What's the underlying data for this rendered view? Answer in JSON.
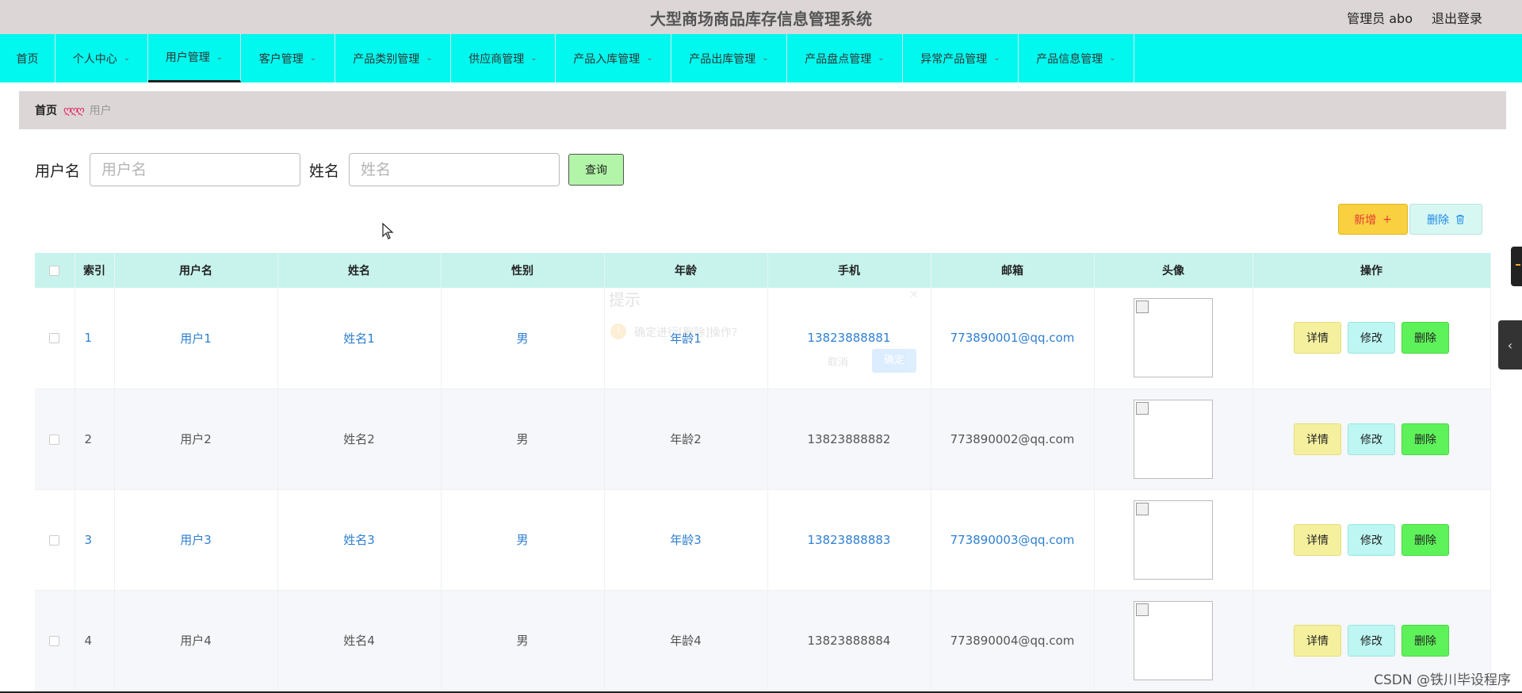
{
  "header": {
    "title": "大型商场商品库存信息管理系统",
    "admin_label": "管理员 abo",
    "logout": "退出登录"
  },
  "nav": [
    {
      "label": "首页",
      "dropdown": false
    },
    {
      "label": "个人中心",
      "dropdown": true
    },
    {
      "label": "用户管理",
      "dropdown": true,
      "active": true
    },
    {
      "label": "客户管理",
      "dropdown": true
    },
    {
      "label": "产品类别管理",
      "dropdown": true
    },
    {
      "label": "供应商管理",
      "dropdown": true
    },
    {
      "label": "产品入库管理",
      "dropdown": true
    },
    {
      "label": "产品出库管理",
      "dropdown": true
    },
    {
      "label": "产品盘点管理",
      "dropdown": true
    },
    {
      "label": "异常产品管理",
      "dropdown": true
    },
    {
      "label": "产品信息管理",
      "dropdown": true
    }
  ],
  "breadcrumb": {
    "home": "首页",
    "separator": "ღღღ",
    "current": "用户"
  },
  "search": {
    "username_label": "用户名",
    "username_placeholder": "用户名",
    "name_label": "姓名",
    "name_placeholder": "姓名",
    "query_button": "查询"
  },
  "actions": {
    "add": "新增",
    "add_icon": "+",
    "delete": "删除",
    "delete_icon": "trash-icon"
  },
  "table": {
    "columns": [
      "索引",
      "用户名",
      "姓名",
      "性别",
      "年龄",
      "手机",
      "邮箱",
      "头像",
      "操作"
    ],
    "rows": [
      {
        "index": "1",
        "username": "用户1",
        "name": "姓名1",
        "gender": "男",
        "age": "年龄1",
        "phone": "13823888881",
        "email": "773890001@qq.com"
      },
      {
        "index": "2",
        "username": "用户2",
        "name": "姓名2",
        "gender": "男",
        "age": "年龄2",
        "phone": "13823888882",
        "email": "773890002@qq.com"
      },
      {
        "index": "3",
        "username": "用户3",
        "name": "姓名3",
        "gender": "男",
        "age": "年龄3",
        "phone": "13823888883",
        "email": "773890003@qq.com"
      },
      {
        "index": "4",
        "username": "用户4",
        "name": "姓名4",
        "gender": "男",
        "age": "年龄4",
        "phone": "13823888884",
        "email": "773890004@qq.com"
      }
    ],
    "row_actions": {
      "detail": "详情",
      "edit": "修改",
      "delete": "删除"
    }
  },
  "faded_dialog": {
    "title": "提示",
    "message": "确定进行[删除]操作?",
    "cancel": "取消",
    "ok": "确定"
  },
  "watermark": "CSDN @铁川毕设程序",
  "colors": {
    "nav_bg": "#00f8ee",
    "header_bg": "#dcd6d6",
    "table_header_bg": "#c7f3ec",
    "add_button": "#f8d040",
    "delete_row_button": "#5ef25a",
    "link_blue": "#2f7fd1"
  }
}
